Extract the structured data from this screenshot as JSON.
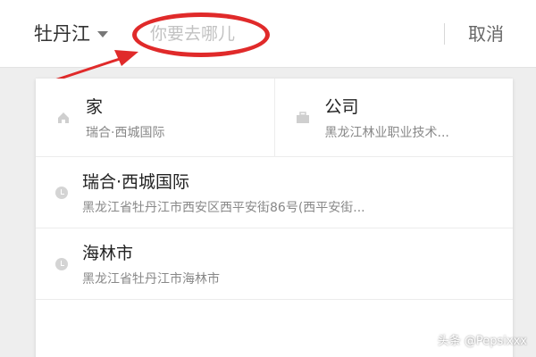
{
  "header": {
    "city": "牡丹江",
    "search_placeholder": "你要去哪儿",
    "cancel_label": "取消"
  },
  "quick_places": [
    {
      "icon": "home-icon",
      "name": "家",
      "address": "瑞合·西城国际"
    },
    {
      "icon": "briefcase-icon",
      "name": "公司",
      "address": "黑龙江林业职业技术..."
    }
  ],
  "history": [
    {
      "icon": "clock-icon",
      "name": "瑞合·西城国际",
      "address": "黑龙江省牡丹江市西安区西平安街86号(西平安街..."
    },
    {
      "icon": "clock-icon",
      "name": "海林市",
      "address": "黑龙江省牡丹江市海林市"
    }
  ],
  "watermark": "头条 @Pepsixxx",
  "colors": {
    "annotation": "#e02a2a",
    "background": "#eeeeee"
  }
}
